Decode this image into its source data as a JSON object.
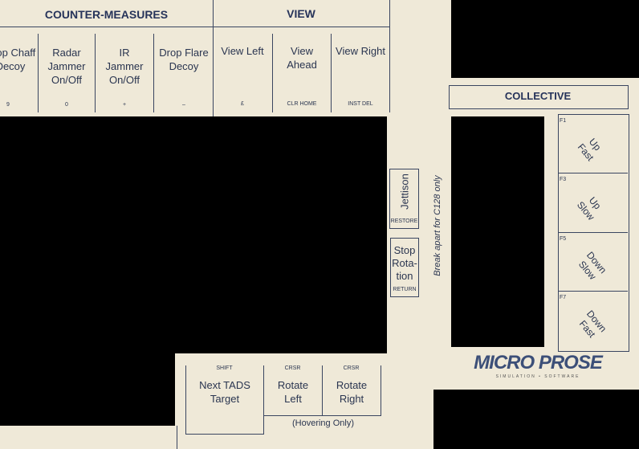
{
  "counter_measures": {
    "title": "COUNTER-MEASURES",
    "keys": [
      {
        "label": "Drop Chaff Decoy",
        "code": "9"
      },
      {
        "label": "Radar Jammer On/Off",
        "code": "0"
      },
      {
        "label": "IR Jammer On/Off",
        "code": "+"
      },
      {
        "label": "Drop Flare Decoy",
        "code": "–"
      }
    ]
  },
  "view": {
    "title": "VIEW",
    "keys": [
      {
        "label": "View Left",
        "code": "£"
      },
      {
        "label": "View Ahead",
        "code": "CLR HOME"
      },
      {
        "label": "View Right",
        "code": "INST DEL"
      }
    ]
  },
  "jettison": {
    "label": "Jettison",
    "code": "RESTORE"
  },
  "stop_rotation": {
    "label": "Stop Rota- tion",
    "code": "RETURN"
  },
  "break_note": "Break apart for C128 only",
  "collective": {
    "title": "COLLECTIVE",
    "keys": [
      {
        "code": "F1",
        "label": "Up Fast"
      },
      {
        "code": "F3",
        "label": "Up Slow"
      },
      {
        "code": "F5",
        "label": "Down Slow"
      },
      {
        "code": "F7",
        "label": "Down Fast"
      }
    ]
  },
  "logo": {
    "name": "MICRO PROSE",
    "tagline": "SIMULATION • SOFTWARE"
  },
  "bottom": {
    "keys": [
      {
        "code": "SHIFT",
        "label": "Next TADS Target"
      },
      {
        "code": "CRSR",
        "label": "Rotate Left"
      },
      {
        "code": "CRSR",
        "label": "Rotate Right"
      }
    ],
    "note": "(Hovering Only)"
  }
}
